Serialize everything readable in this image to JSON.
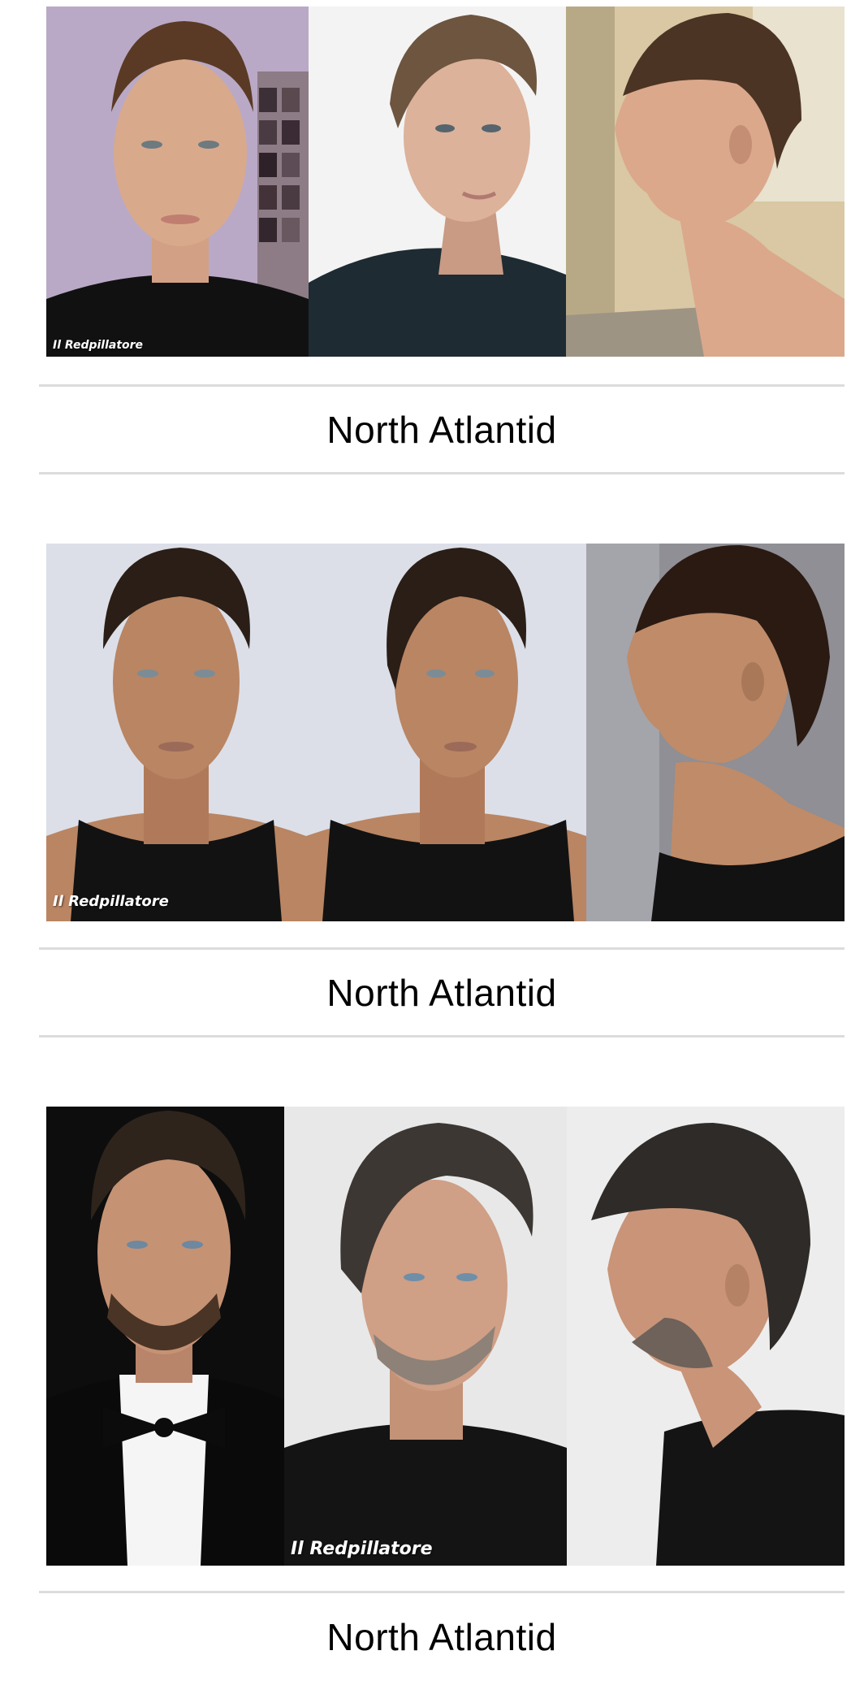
{
  "sections": [
    {
      "caption": "North Atlantid",
      "watermark": "Il Redpillatore",
      "photos": [
        {
          "view": "front",
          "bg": "#b9a9c6",
          "hair": "#5a3a24",
          "skin": "#d9a98c",
          "top": "#111111"
        },
        {
          "view": "three-quarter",
          "bg": "#f3f3f3",
          "hair": "#6d553f",
          "skin": "#dcb29a",
          "top": "#1e2b33"
        },
        {
          "view": "profile",
          "bg": "#d9c8a3",
          "hair": "#4b3424",
          "skin": "#dba88c",
          "top": "#dba88c"
        }
      ]
    },
    {
      "caption": "North Atlantid",
      "watermark": "Il Redpillatore",
      "photos": [
        {
          "view": "front",
          "bg": "#dcdfe8",
          "hair": "#2a1e16",
          "skin": "#b98563",
          "top": "#121212"
        },
        {
          "view": "three-quarter",
          "bg": "#dcdfe8",
          "hair": "#2a1e16",
          "skin": "#b98563",
          "top": "#121212"
        },
        {
          "view": "profile",
          "bg": "#8f8f95",
          "hair": "#2a1a12",
          "skin": "#c08b69",
          "top": "#121212"
        }
      ]
    },
    {
      "caption": "North Atlantid",
      "watermark": "Il Redpillatore",
      "photos": [
        {
          "view": "front",
          "bg": "#0d0d0d",
          "hair": "#2e241c",
          "skin": "#c69274",
          "top": "#0a0a0a"
        },
        {
          "view": "three-quarter",
          "bg": "#e8e8e8",
          "hair": "#3c3733",
          "skin": "#cf9f86",
          "top": "#141414"
        },
        {
          "view": "profile",
          "bg": "#ededed",
          "hair": "#2f2b28",
          "skin": "#c99478",
          "top": "#141414"
        }
      ]
    }
  ]
}
